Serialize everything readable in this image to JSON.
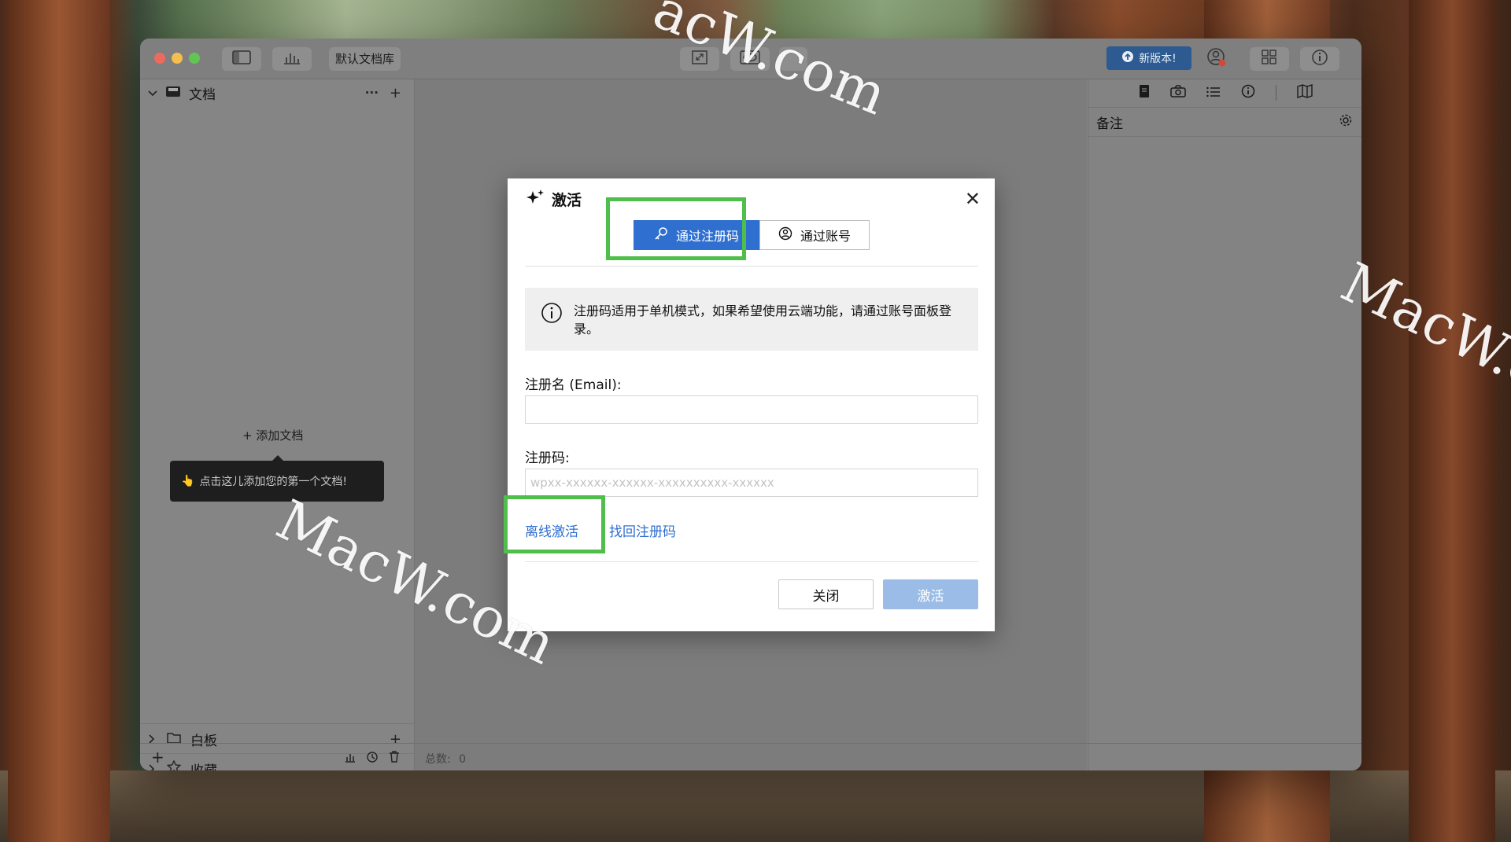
{
  "toolbar": {
    "library_name": "默认文档库",
    "update_label": "新版本!"
  },
  "sidebar": {
    "documents_label": "文档",
    "add_document_label": "添加文档",
    "tooltip_text": "点击这儿添加您的第一个文档!",
    "whiteboard_label": "白板",
    "favorites_label": "收藏"
  },
  "right_panel": {
    "notes_title": "备注"
  },
  "footer": {
    "total_label": "总数:",
    "total_value": "0"
  },
  "dialog": {
    "title": "激活",
    "tabs": [
      {
        "label": "通过注册码",
        "active": true
      },
      {
        "label": "通过账号",
        "active": false
      }
    ],
    "info_text": "注册码适用于单机模式，如果希望使用云端功能，请通过账号面板登录。",
    "email_label": "注册名 (Email):",
    "email_value": "",
    "code_label": "注册码:",
    "code_placeholder": "wpxx-xxxxxx-xxxxxx-xxxxxxxxxx-xxxxxx",
    "offline_link": "离线激活",
    "recover_link": "找回注册码",
    "close_button": "关闭",
    "activate_button": "激活"
  },
  "watermark": {
    "text": "MacW.com",
    "partial_top": "acW.com",
    "partial_right": "MacW.c"
  },
  "colors": {
    "primary_blue": "#2f6fd0",
    "disabled_blue": "#9bbce6",
    "highlight_green": "#4fbe4a",
    "update_badge": "#2c5a91"
  }
}
